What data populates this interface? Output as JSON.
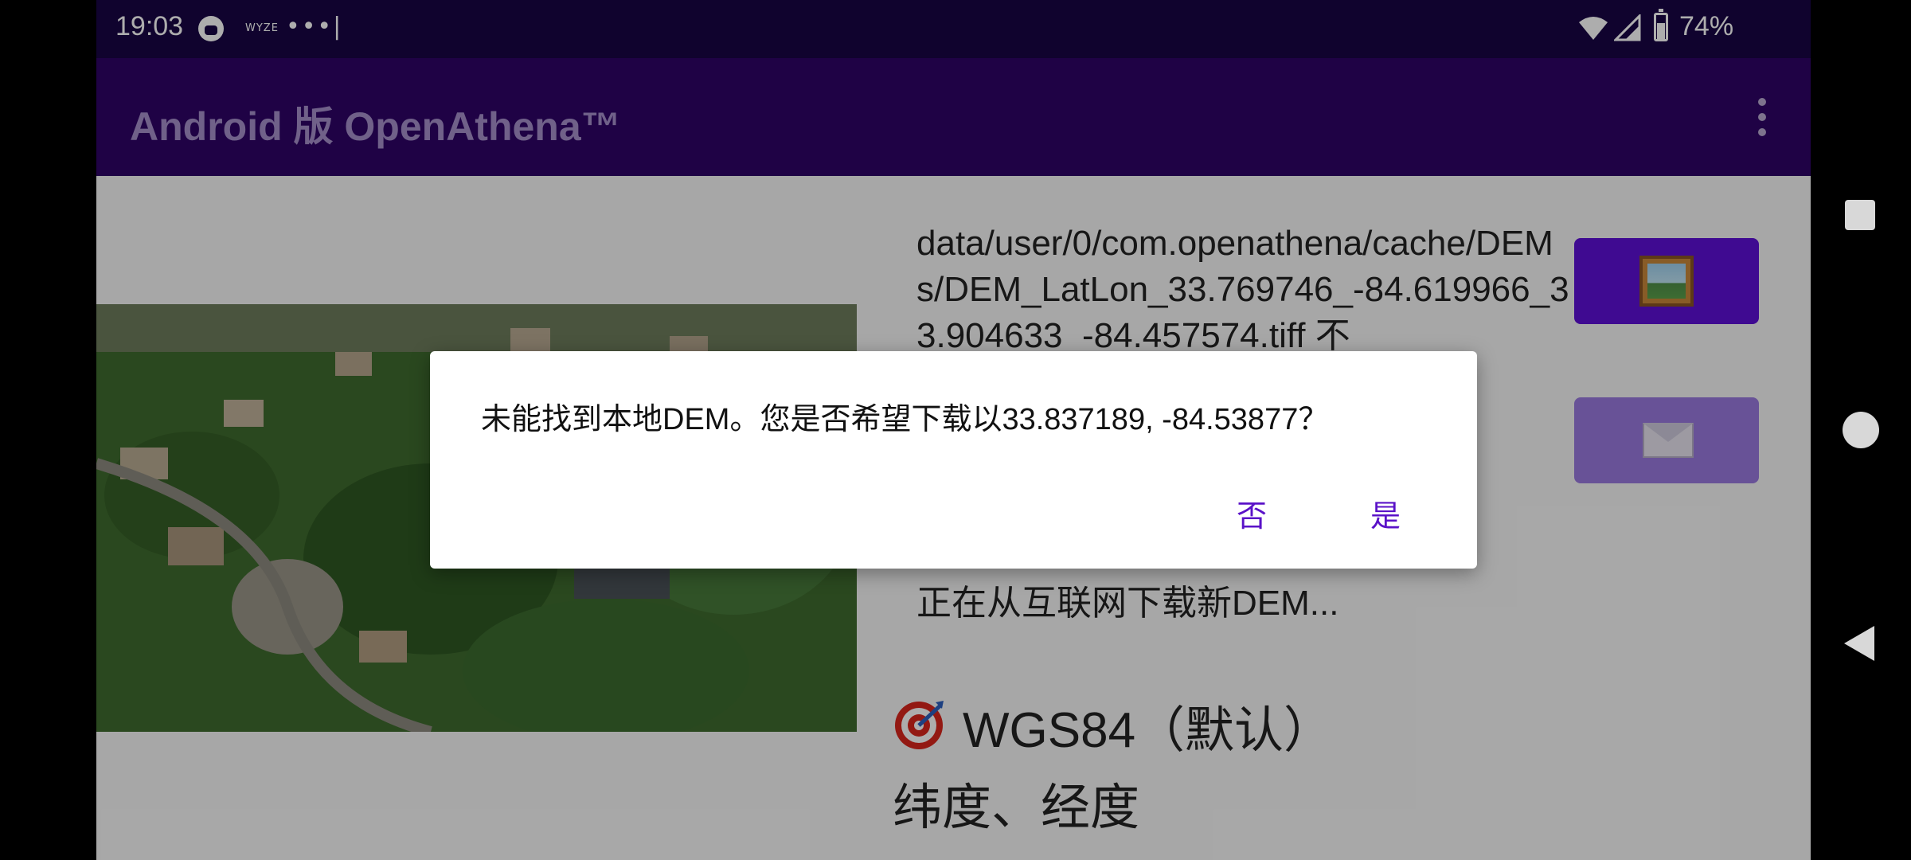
{
  "status_bar": {
    "time": "19:03",
    "wyze_label": "WYZE",
    "overflow": "•••|",
    "battery": "74%"
  },
  "app_bar": {
    "title": "Android 版 OpenAthena™"
  },
  "main": {
    "dem_path_text": "data/user/0/com.openathena/cache/DEMs/DEM_LatLon_33.769746_-84.619966_33.904633_-84.457574.tiff 不",
    "downloading_text": "正在从互联网下载新DEM...",
    "coord_system": "WGS84（默认）",
    "coord_format": "纬度、经度"
  },
  "dialog": {
    "message": "未能找到本地DEM。您是否希望下载以33.837189, -84.53877？",
    "no_label": "否",
    "yes_label": "是"
  },
  "colors": {
    "status_bar_bg": "#190545",
    "app_bar_bg": "#2e0466",
    "accent": "#5e10d6",
    "dialog_button": "#5a12c8"
  },
  "icons": {
    "image_button": "framed-picture-icon",
    "mail_button": "envelope-icon",
    "coord_system": "target-icon",
    "menu": "overflow-menu-icon"
  }
}
